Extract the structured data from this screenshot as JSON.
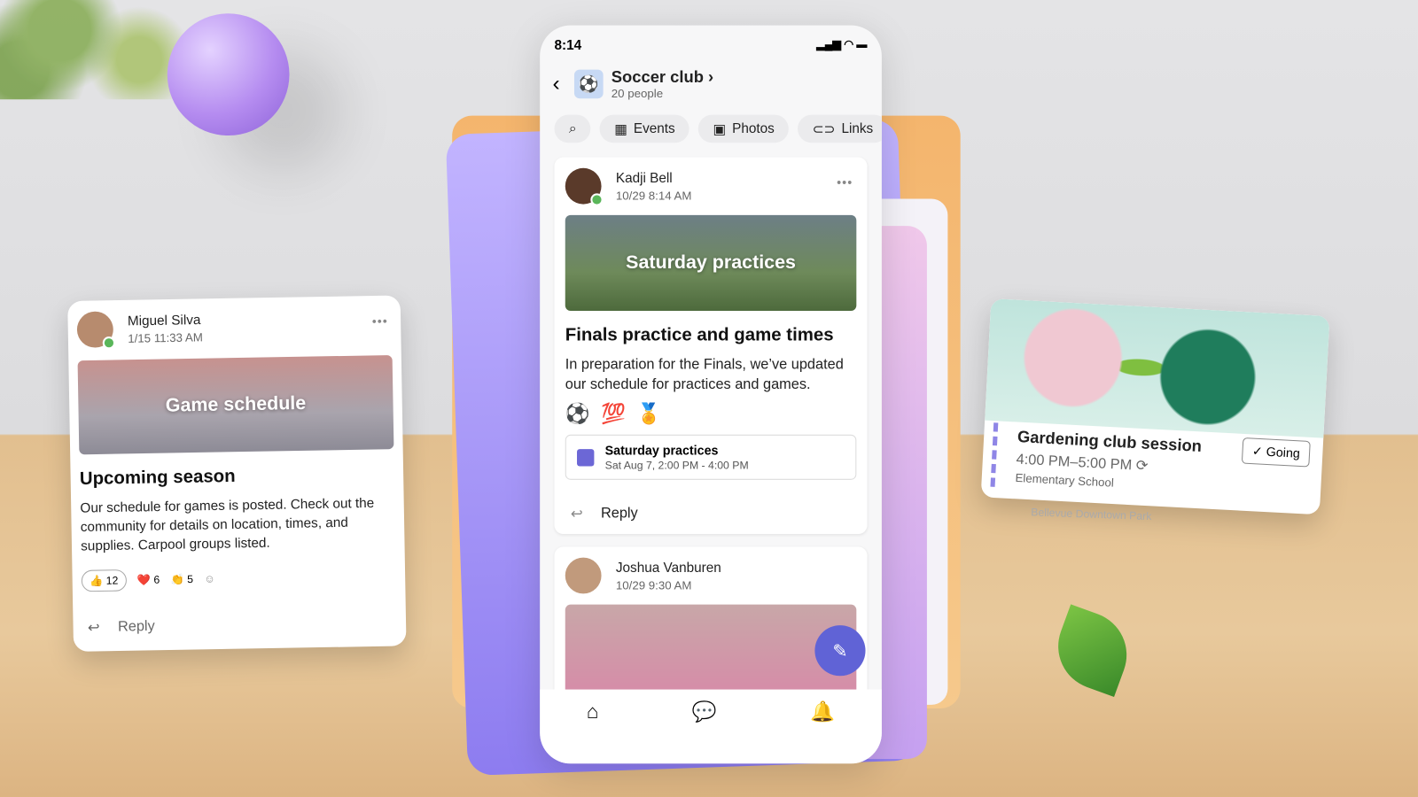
{
  "phone": {
    "status_time": "8:14",
    "club": {
      "name": "Soccer club",
      "chevron": "›",
      "members": "20 people"
    },
    "tabs": [
      {
        "label": "",
        "icon": "search-icon"
      },
      {
        "label": "Events",
        "icon": "calendar-icon"
      },
      {
        "label": "Photos",
        "icon": "image-icon"
      },
      {
        "label": "Links",
        "icon": "link-icon"
      }
    ],
    "posts": [
      {
        "author": "Kadji Bell",
        "time": "10/29 8:14 AM",
        "banner": "Saturday practices",
        "title": "Finals practice and game times",
        "body": "In preparation for the Finals, we’ve updated our schedule for practices and games.",
        "reactions": [
          "⚽",
          "💯",
          "🏅"
        ],
        "event": {
          "title": "Saturday practices",
          "time": "Sat Aug 7, 2:00 PM - 4:00 PM"
        },
        "reply": "Reply"
      },
      {
        "author": "Joshua Vanburen",
        "time": "10/29 9:30 AM"
      }
    ],
    "nav": [
      "home-icon",
      "chat-icon",
      "bell-icon"
    ],
    "accent": "#6063d6"
  },
  "left_card": {
    "author": "Miguel Silva",
    "time": "1/15 11:33 AM",
    "banner": "Game schedule",
    "title": "Upcoming season",
    "body": "Our schedule for games is posted. Check out the community for details on location, times, and supplies. Carpool groups listed.",
    "reactions": [
      {
        "emoji": "👍",
        "count": "12"
      },
      {
        "emoji": "❤️",
        "count": "6"
      },
      {
        "emoji": "👏",
        "count": "5"
      }
    ],
    "reply": "Reply"
  },
  "right_card": {
    "title": "Gardening club session",
    "time": "4:00 PM–5:00 PM",
    "location": "Elementary School",
    "rsvp": "Going",
    "behind_location": "Bellevue Downtown Park"
  }
}
